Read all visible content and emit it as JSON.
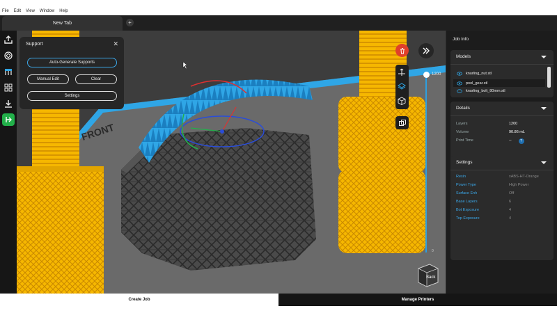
{
  "menu": [
    "File",
    "Edit",
    "View",
    "Window",
    "Help"
  ],
  "tabs": [
    {
      "label": "New Tab"
    }
  ],
  "tab_add_label": "+",
  "left_toolbar": {
    "icons": [
      "upload-icon",
      "rotate-3d-icon",
      "support-icon",
      "layout-grid-icon",
      "download-icon",
      "exit-icon"
    ]
  },
  "viewport": {
    "build_plate_text": "FRONT",
    "view_cube_label": "Back"
  },
  "support_panel": {
    "title": "Support",
    "auto_generate_label": "Auto-Generate Supports",
    "manual_edit_label": "Manual Edit",
    "clear_label": "Clear",
    "settings_label": "Settings"
  },
  "layer_slider": {
    "top_value": "1200",
    "bottom_value": "0",
    "level": 1.0
  },
  "viewport_tools": [
    "trash-icon",
    "collapse-panel-icon",
    "move-gizmo-icon",
    "layer-view-icon",
    "cube-view-icon",
    "duplicate-icon"
  ],
  "job_info": {
    "title": "Job Info",
    "models": {
      "heading": "Models",
      "items": [
        {
          "name": "knurling_nut.stl",
          "selected": false
        },
        {
          "name": "pool_gear.stl",
          "selected": true
        },
        {
          "name": "knurling_bolt_80mm.stl",
          "selected": false
        }
      ]
    },
    "details": {
      "heading": "Details",
      "rows": [
        {
          "key": "Layers",
          "value": "1200"
        },
        {
          "key": "Volume",
          "value": "90.86 mL"
        },
        {
          "key": "Print Time",
          "value": "--"
        }
      ],
      "help_label": "?"
    },
    "settings": {
      "heading": "Settings",
      "rows": [
        {
          "key": "Resin",
          "value": "xABS-HT-Orange"
        },
        {
          "key": "Power Type",
          "value": "High Power"
        },
        {
          "key": "Surface Enh",
          "value": "Off"
        },
        {
          "key": "Base Layers",
          "value": "6"
        },
        {
          "key": "Bot Exposure",
          "value": "4"
        },
        {
          "key": "Top Exposure",
          "value": "4"
        }
      ]
    }
  },
  "bottom": {
    "create_job_label": "Create Job",
    "manage_printers_label": "Manage Printers"
  },
  "colors": {
    "accent": "#3ba7e8",
    "model_orange": "#f6b700",
    "support_grey": "#3a3a3a",
    "gear_blue": "#2fa6e6",
    "trash_red": "#e0402a",
    "exit_green": "#22b04a"
  }
}
